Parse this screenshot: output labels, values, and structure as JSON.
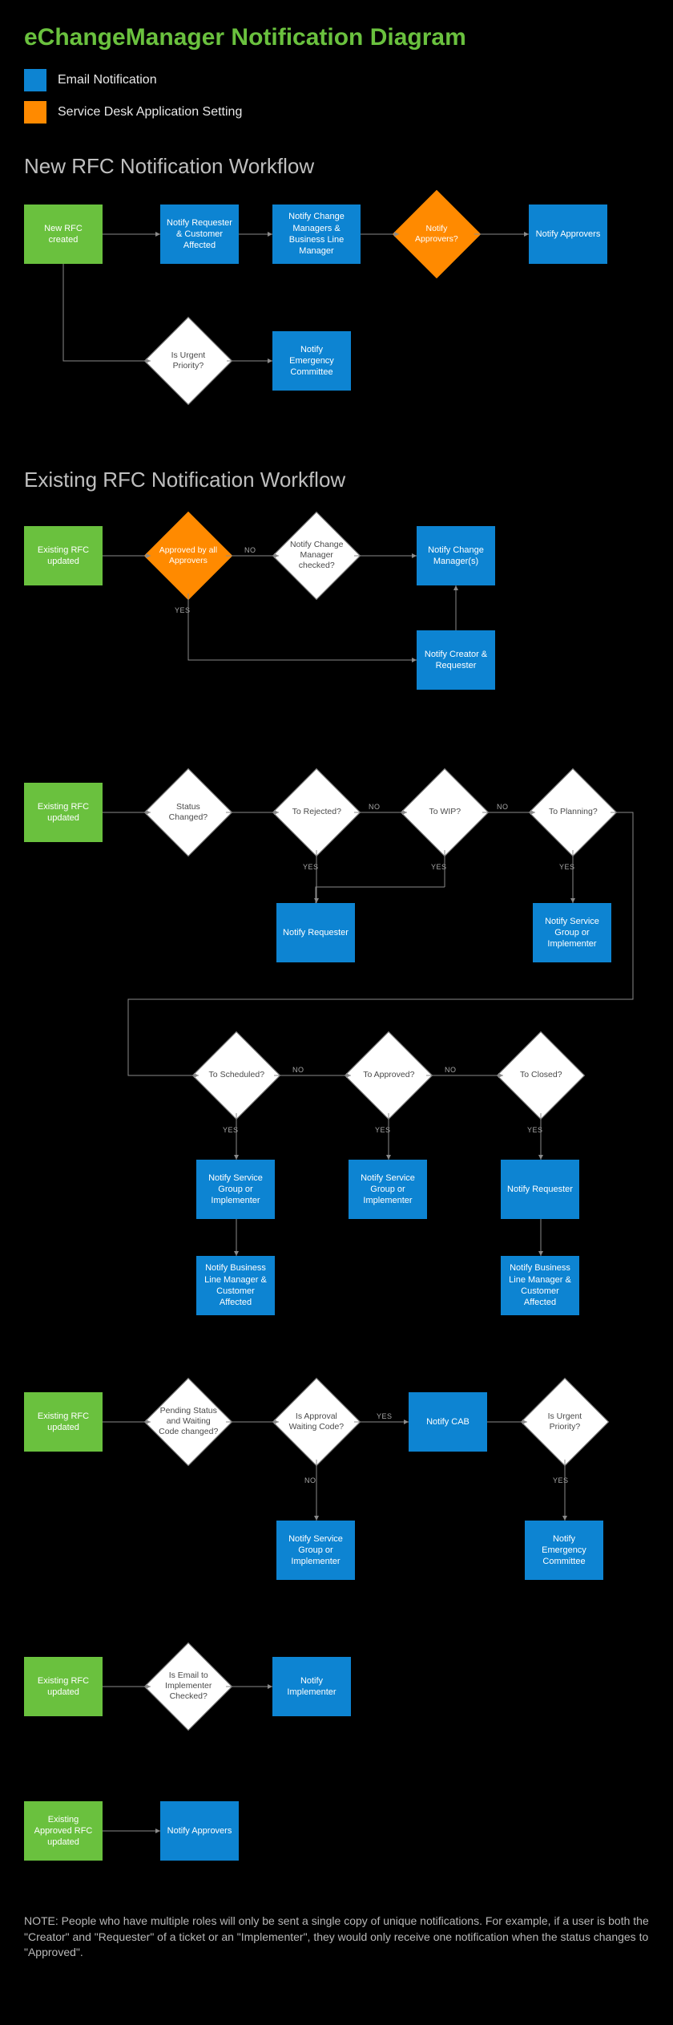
{
  "title": "eChangeManager Notification Diagram",
  "legend": {
    "email": "Email Notification",
    "setting": "Service Desk Application Setting"
  },
  "sections": {
    "new_rfc": "New RFC Notification Workflow",
    "existing_rfc": "Existing RFC Notification Workflow"
  },
  "nodes": {
    "new_rfc_created": "New RFC created",
    "notify_req_cust": "Notify Requester & Customer Affected",
    "notify_cm_blm": "Notify Change Managers & Business Line Manager",
    "notify_approvers_q": "Notify Approvers?",
    "notify_approvers": "Notify Approvers",
    "is_urgent": "Is Urgent Priority?",
    "notify_emergency": "Notify Emergency Committee",
    "existing_updated": "Existing RFC updated",
    "approved_all": "Approved by all Approvers",
    "notify_cm_checked": "Notify Change Manager checked?",
    "notify_cms": "Notify Change Manager(s)",
    "notify_creator_req": "Notify Creator & Requester",
    "status_changed": "Status Changed?",
    "to_rejected": "To Rejected?",
    "to_wip": "To WIP?",
    "to_planning": "To Planning?",
    "notify_requester": "Notify Requester",
    "notify_sg_impl": "Notify Service Group or Implementer",
    "to_scheduled": "To Scheduled?",
    "to_approved": "To Approved?",
    "to_closed": "To Closed?",
    "notify_blm_cust": "Notify Business Line Manager & Customer Affected",
    "pending_changed": "Pending Status and Waiting Code changed?",
    "is_approval_code": "Is Approval Waiting Code?",
    "notify_cab": "Notify CAB",
    "email_impl_checked": "Is Email to Implementer Checked?",
    "notify_impl": "Notify Implementer",
    "existing_approved_updated": "Existing Approved RFC updated"
  },
  "labels": {
    "yes": "YES",
    "no": "NO"
  },
  "note": "NOTE: People who have multiple roles will only be sent a single copy of unique notifications. For example, if a user is both the \"Creator\" and \"Requester\" of a ticket or an \"Implementer\", they would only receive one notification when the status changes to \"Approved\"."
}
